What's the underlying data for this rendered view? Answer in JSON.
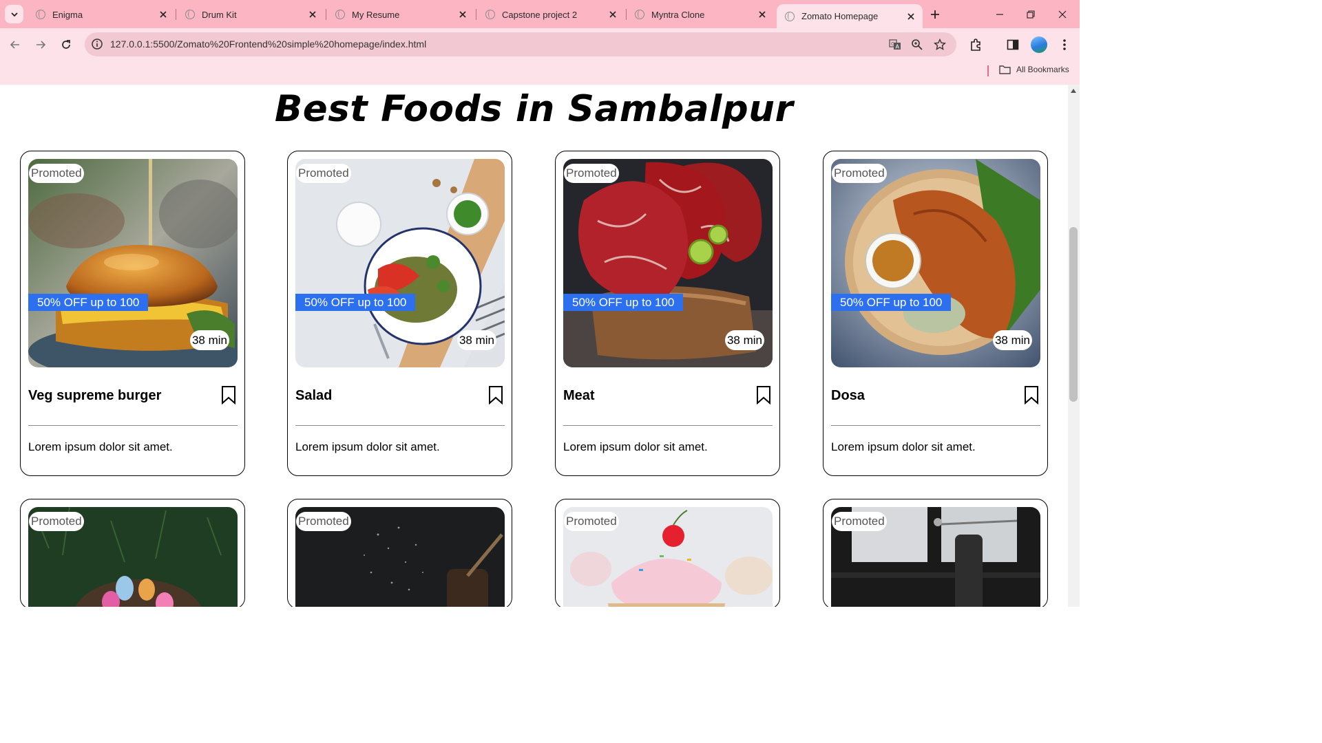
{
  "browser": {
    "tabs": [
      {
        "title": "Enigma"
      },
      {
        "title": "Drum Kit"
      },
      {
        "title": "My Resume"
      },
      {
        "title": "Capstone project 2"
      },
      {
        "title": "Myntra Clone"
      },
      {
        "title": "Zomato Homepage",
        "active": true
      }
    ],
    "url": "127.0.0.1:5500/Zomato%20Frontend%20simple%20homepage/index.html",
    "bookmarks_label": "All Bookmarks"
  },
  "page": {
    "heading": "Best Foods in Sambalpur",
    "cards": [
      {
        "badge": "Promoted",
        "offer": "50% OFF up to 100",
        "time": "38 min",
        "name": "Veg supreme burger",
        "description": "Lorem ipsum dolor sit amet.",
        "image": "burger"
      },
      {
        "badge": "Promoted",
        "offer": "50% OFF up to 100",
        "time": "38 min",
        "name": "Salad",
        "description": "Lorem ipsum dolor sit amet.",
        "image": "salad"
      },
      {
        "badge": "Promoted",
        "offer": "50% OFF up to 100",
        "time": "38 min",
        "name": "Meat",
        "description": "Lorem ipsum dolor sit amet.",
        "image": "meat"
      },
      {
        "badge": "Promoted",
        "offer": "50% OFF up to 100",
        "time": "38 min",
        "name": "Dosa",
        "description": "Lorem ipsum dolor sit amet.",
        "image": "dosa"
      },
      {
        "badge": "Promoted",
        "image": "easter-eggs"
      },
      {
        "badge": "Promoted",
        "image": "dark-spices"
      },
      {
        "badge": "Promoted",
        "image": "cupcake"
      },
      {
        "badge": "Promoted",
        "image": "tea"
      }
    ]
  }
}
